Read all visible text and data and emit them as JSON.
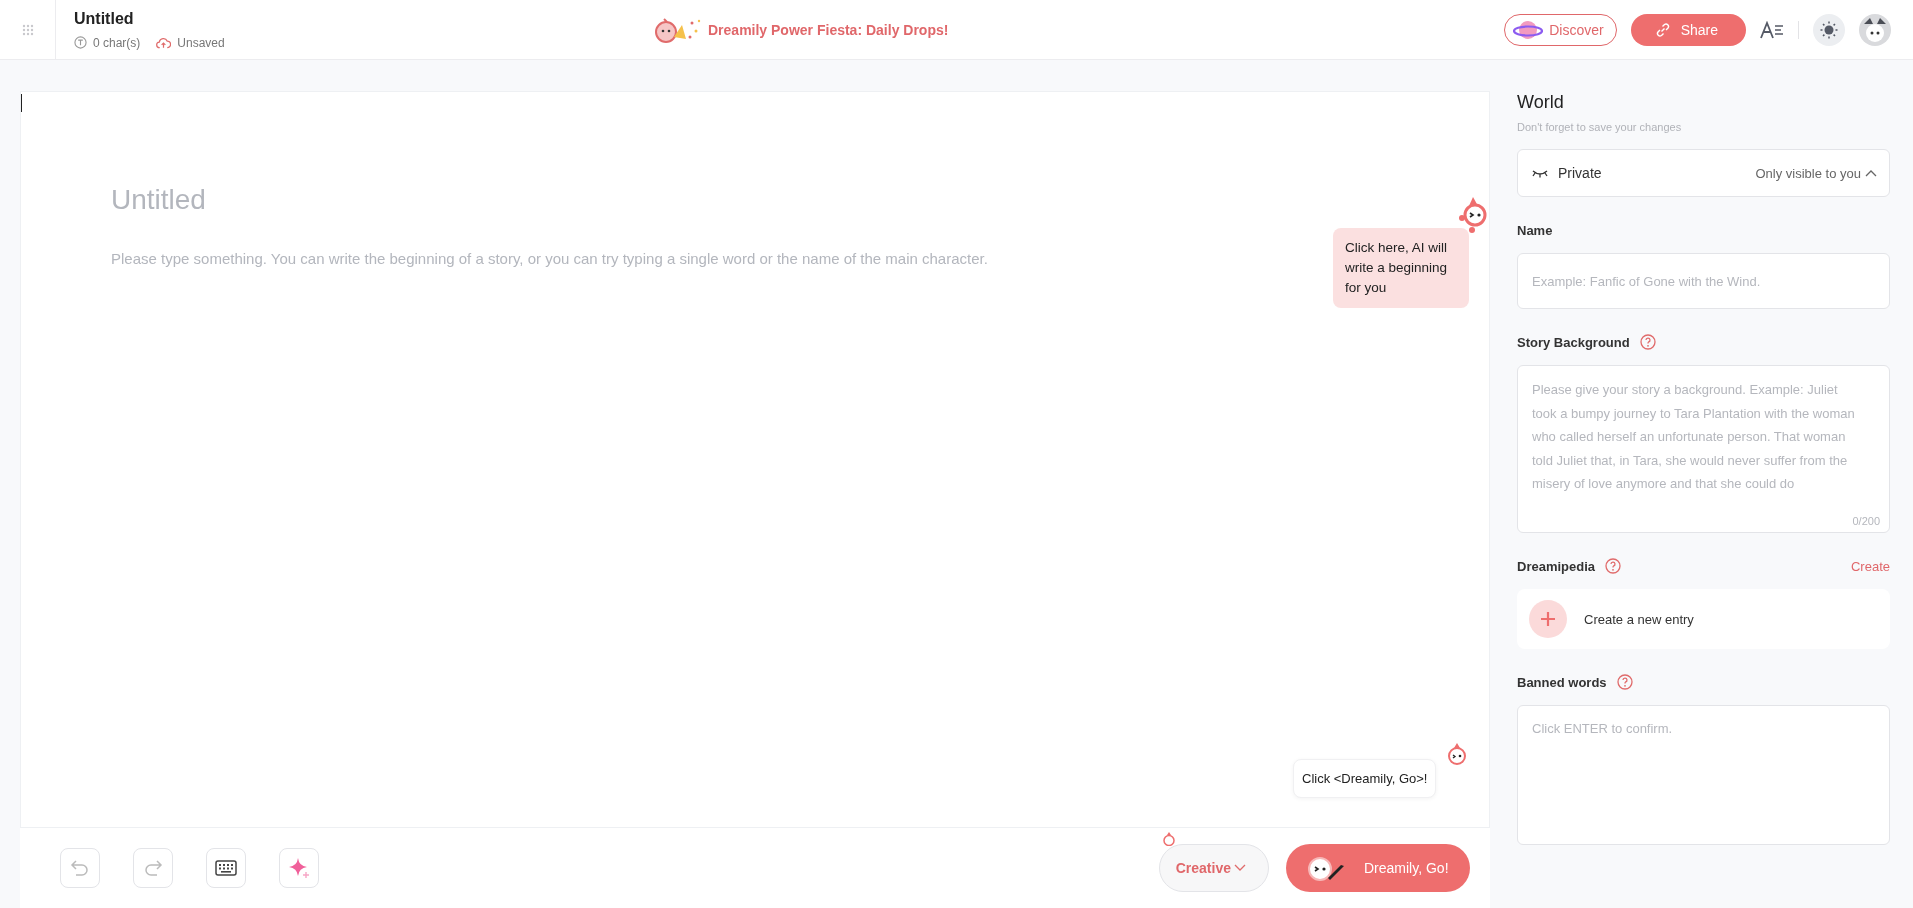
{
  "header": {
    "title": "Untitled",
    "char_count": "0 char(s)",
    "save_status": "Unsaved",
    "promo": "Dreamily Power Fiesta: Daily Drops!",
    "discover": "Discover",
    "share": "Share"
  },
  "editor": {
    "title_placeholder": "Untitled",
    "body_placeholder": "Please type something. You can write the beginning of a story, or you can try typing a single word or the name of the main character.",
    "ai_tip": "Click here, AI will write a beginning for you",
    "go_tip": "Click <Dreamily, Go>!"
  },
  "toolbar": {
    "mode": "Creative",
    "go": "Dreamily, Go!"
  },
  "panel": {
    "title": "World",
    "subtitle": "Don't forget to save your changes",
    "visibility": {
      "label": "Private",
      "hint": "Only visible to you",
      "expanded": true
    },
    "name": {
      "label": "Name",
      "placeholder": "Example: Fanfic of Gone with the Wind."
    },
    "background": {
      "label": "Story Background",
      "placeholder": "Please give your story a background. Example: Juliet took a bumpy journey to Tara Plantation with the woman who called herself an unfortunate person. That woman told Juliet that, in Tara, she would never suffer from the misery of love anymore and that she could do",
      "count": "0/200"
    },
    "dreamipedia": {
      "label": "Dreamipedia",
      "create": "Create",
      "new_entry": "Create a new entry"
    },
    "banned": {
      "label": "Banned words",
      "placeholder": "Click ENTER to confirm."
    }
  }
}
